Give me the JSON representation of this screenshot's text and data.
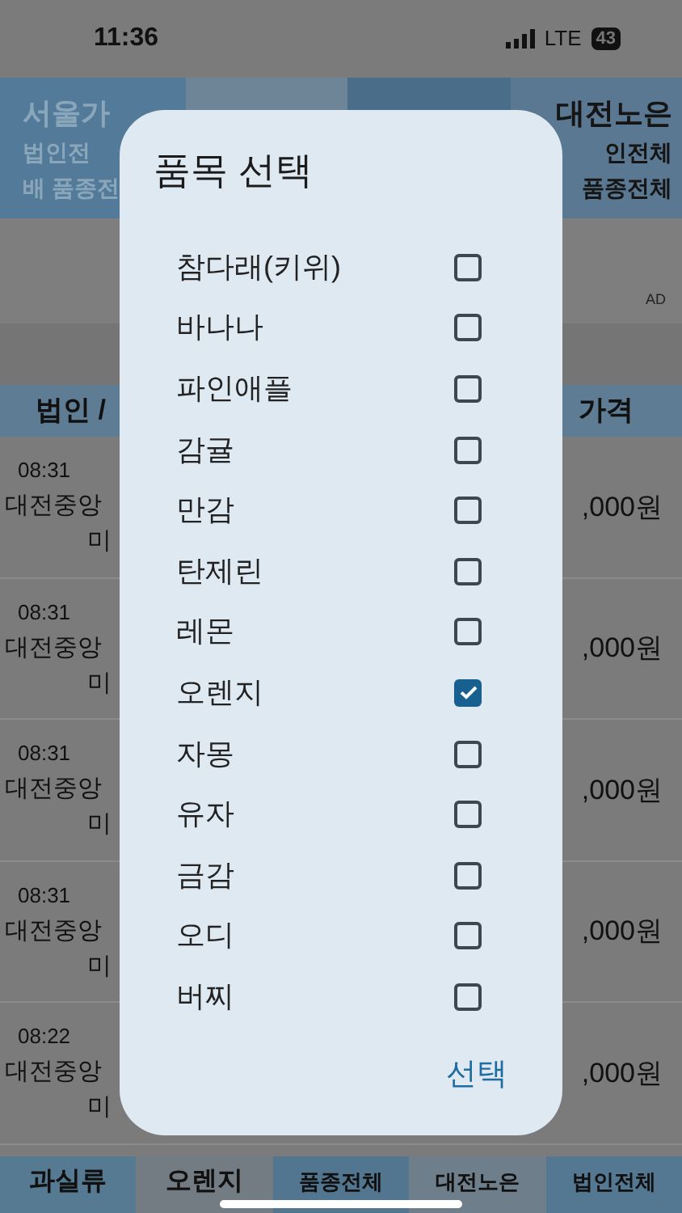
{
  "status_bar": {
    "time": "11:36",
    "network": "LTE",
    "battery": "43"
  },
  "header_tabs": [
    {
      "lines": [
        "서울가",
        "법인전",
        "배 품종전"
      ],
      "selected": false
    },
    {
      "lines": [
        "대전노은",
        "인전체",
        "품종전체"
      ],
      "selected": true
    }
  ],
  "ad_label": "AD",
  "table": {
    "columns": [
      "법인 /",
      "가격"
    ],
    "rows": [
      {
        "time": "08:31",
        "market": "대전중앙",
        "variety": "미",
        "price": ",000원"
      },
      {
        "time": "08:31",
        "market": "대전중앙",
        "variety": "미",
        "price": ",000원"
      },
      {
        "time": "08:31",
        "market": "대전중앙",
        "variety": "미",
        "price": ",000원"
      },
      {
        "time": "08:31",
        "market": "대전중앙",
        "variety": "미",
        "price": ",000원"
      },
      {
        "time": "08:22",
        "market": "대전중앙",
        "variety": "미",
        "price": ",000원"
      }
    ]
  },
  "bottom_bar": [
    "과실류",
    "오렌지",
    "품종전체",
    "대전노은",
    "법인전체"
  ],
  "dialog": {
    "title": "품목 선택",
    "confirm": "선택",
    "items": [
      {
        "label": "참다래(키위)",
        "checked": false
      },
      {
        "label": "바나나",
        "checked": false
      },
      {
        "label": "파인애플",
        "checked": false
      },
      {
        "label": "감귤",
        "checked": false
      },
      {
        "label": "만감",
        "checked": false
      },
      {
        "label": "탄제린",
        "checked": false
      },
      {
        "label": "레몬",
        "checked": false
      },
      {
        "label": "오렌지",
        "checked": true
      },
      {
        "label": "자몽",
        "checked": false
      },
      {
        "label": "유자",
        "checked": false
      },
      {
        "label": "금감",
        "checked": false
      },
      {
        "label": "오디",
        "checked": false
      },
      {
        "label": "버찌",
        "checked": false
      }
    ]
  }
}
